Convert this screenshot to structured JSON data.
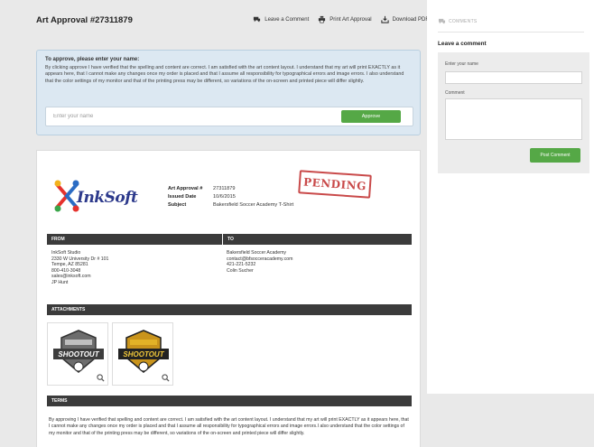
{
  "header": {
    "title": "Art Approval #27311879",
    "actions": [
      {
        "label": "Leave a Comment",
        "icon": "comment-icon"
      },
      {
        "label": "Print Art Approval",
        "icon": "print-icon"
      },
      {
        "label": "Download PDF",
        "icon": "download-icon"
      }
    ]
  },
  "approve": {
    "title": "To approve, please enter your name:",
    "text": "By clicking approve I have verified that the spelling and content are correct. I am satisfied with the art content layout. I understand that my art will print EXACTLY as it appears here, that I cannot make any changes once my order is placed and that I assume all responsibility for typographical errors and image errors. I also understand that the color settings of my monitor and that of the printing press may be different, so variations of the on-screen and printed piece will differ slightly.",
    "placeholder": "Enter your name",
    "button": "Approve"
  },
  "document": {
    "logo_text": "InkSoft",
    "stamp": "PENDING",
    "meta": [
      {
        "key": "Art Approval #",
        "value": "27311879"
      },
      {
        "key": "Issued Date",
        "value": "10/6/2015"
      },
      {
        "key": "Subject",
        "value": "Bakersfield Soccer Academy T-Shirt"
      }
    ],
    "from_label": "FROM",
    "to_label": "TO",
    "from_lines": [
      "InkSoft Studio",
      "2330 W University Dr # 101",
      "Tempe, AZ 85281",
      "800-410-3048",
      "sales@inksoft.com",
      "JP Hunt"
    ],
    "to_lines": [
      "Bakersfield Soccer Academy",
      "contact@bfsocceracademy.com",
      "421-221-5232",
      "Colin Sucher"
    ],
    "attachments_label": "ATTACHMENTS",
    "attachments": [
      {
        "name": "SHOOTOUT",
        "banner": "#3d3d3d",
        "accent": "#bfbfbf"
      },
      {
        "name": "SHOOTOUT",
        "banner": "#222222",
        "accent": "#e2b227"
      }
    ],
    "terms_label": "TERMS",
    "terms_text": "By approving I have verified that spelling and content are correct. I am satisfied with the art content layout. I understand that my art will print EXACTLY as it appears here, that I cannot make any changes once my order is placed and that I assume all responsibility for typographical errors and image errors.I also understand that the color settings of my monitor and that of the printing press may be different, so variations of the on-screen and printed piece will differ slightly."
  },
  "sidebar": {
    "head": "COMMENTS",
    "title": "Leave a comment",
    "name_label": "Enter your name",
    "comment_label": "Comment",
    "button": "Post Comment"
  },
  "colors": {
    "green": "#55a846",
    "stamp": "#c94a4a",
    "bar": "#3b3b3b",
    "panel": "#dce8f2"
  }
}
